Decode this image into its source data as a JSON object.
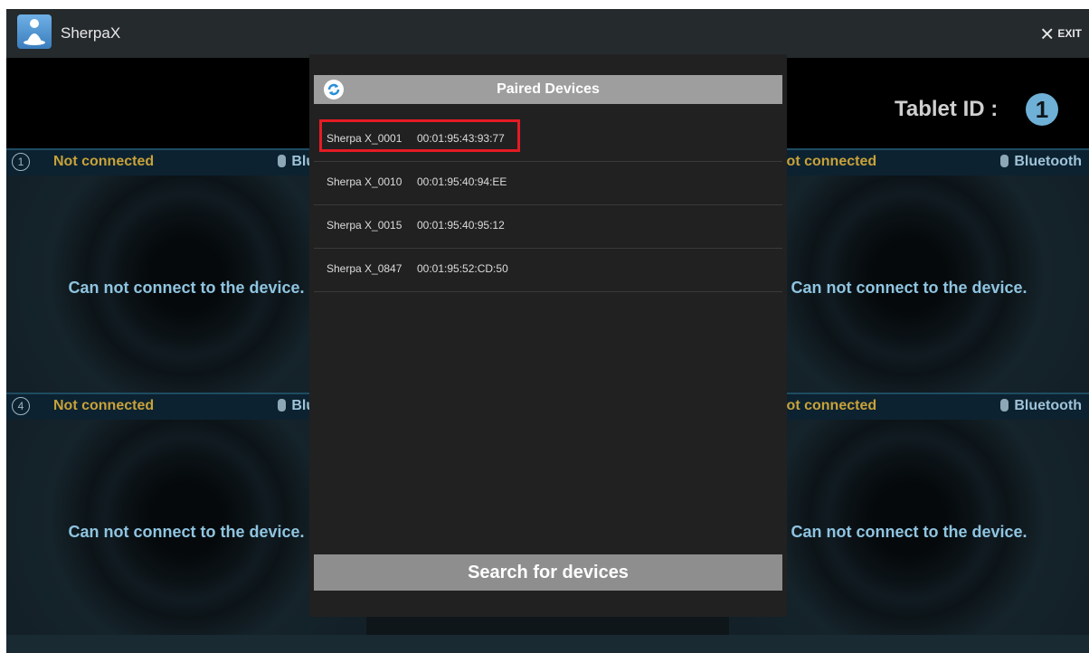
{
  "app": {
    "title": "SherpaX",
    "exit_label": "EXIT"
  },
  "tablet": {
    "label": "Tablet ID :",
    "id": "1"
  },
  "panels": [
    {
      "number": "1",
      "status": "Not connected",
      "bluetooth": "Bluetooth",
      "message": "Can not connect to the device."
    },
    {
      "number": "",
      "status": "Not connected",
      "bluetooth": "Bluetooth",
      "message": "Can not connect to the device."
    },
    {
      "number": "4",
      "status": "Not connected",
      "bluetooth": "Bluetooth",
      "message": "Can not connect to the device."
    },
    {
      "number": "",
      "status": "Not connected",
      "bluetooth": "Bluetooth",
      "message": "Can not connect to the device."
    }
  ],
  "dialog": {
    "title": "Paired Devices",
    "devices": [
      {
        "name": "Sherpa X_0001",
        "mac": "00:01:95:43:93:77",
        "highlighted": true
      },
      {
        "name": "Sherpa X_0010",
        "mac": "00:01:95:40:94:EE"
      },
      {
        "name": "Sherpa X_0015",
        "mac": "00:01:95:40:95:12"
      },
      {
        "name": "Sherpa X_0847",
        "mac": "00:01:95:52:CD:50"
      }
    ],
    "search_button": "Search for devices"
  },
  "colors": {
    "status_warning": "#c8a23a",
    "message": "#8fc4e0",
    "highlight": "#e51b24",
    "dialog_bg": "#212121"
  }
}
